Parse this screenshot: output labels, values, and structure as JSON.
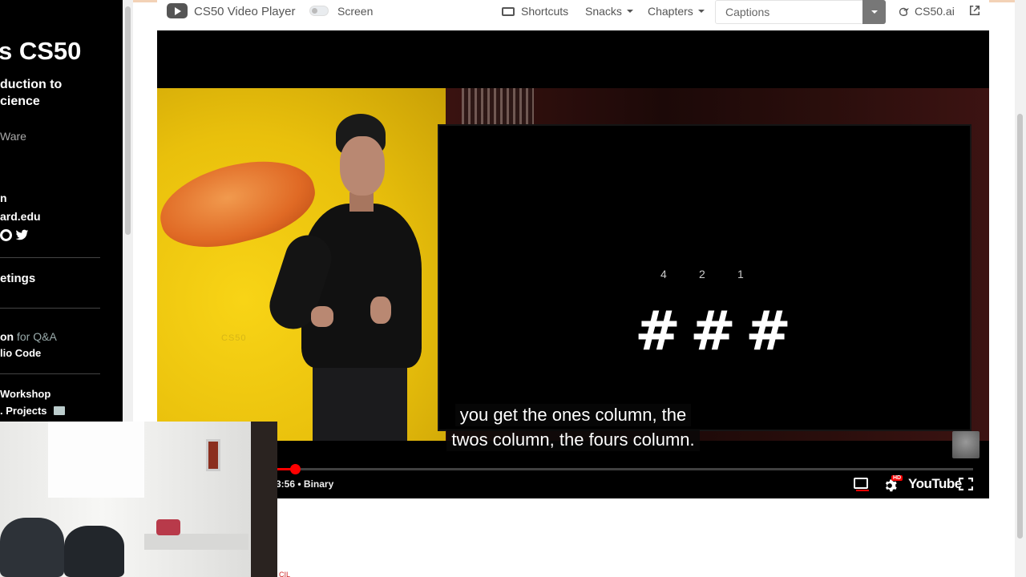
{
  "sidebar": {
    "title": "s CS50",
    "subtitle_line1": "duction to",
    "subtitle_line2": "cience",
    "ware": "Ware",
    "n": "n",
    "email": "ard.edu",
    "meetings": "etings",
    "qa_label": "on",
    "qa_muted": " for Q&A",
    "vscode": "lio Code",
    "workshop": "Workshop",
    "projects": ". Projects"
  },
  "toolbar": {
    "title": "CS50 Video Player",
    "screen_label": "Screen",
    "shortcuts": "Shortcuts",
    "snacks": "Snacks",
    "chapters": "Chapters",
    "captions_placeholder": "Captions",
    "cs50ai": "CS50.ai"
  },
  "slide": {
    "place_values": [
      "4",
      "2",
      "1"
    ],
    "hashes": [
      "#",
      "#",
      "#"
    ]
  },
  "video": {
    "duck_mark": "CS50",
    "subtitle_line1": "you get the ones column, the",
    "subtitle_line2": "twos column, the fours column.",
    "time": "3:56",
    "chapter_sep": "•",
    "chapter": "Binary",
    "progress": 0.025,
    "hd_badge": "HD",
    "youtube": "YouTube"
  },
  "webcam": {
    "label": "CIL"
  }
}
